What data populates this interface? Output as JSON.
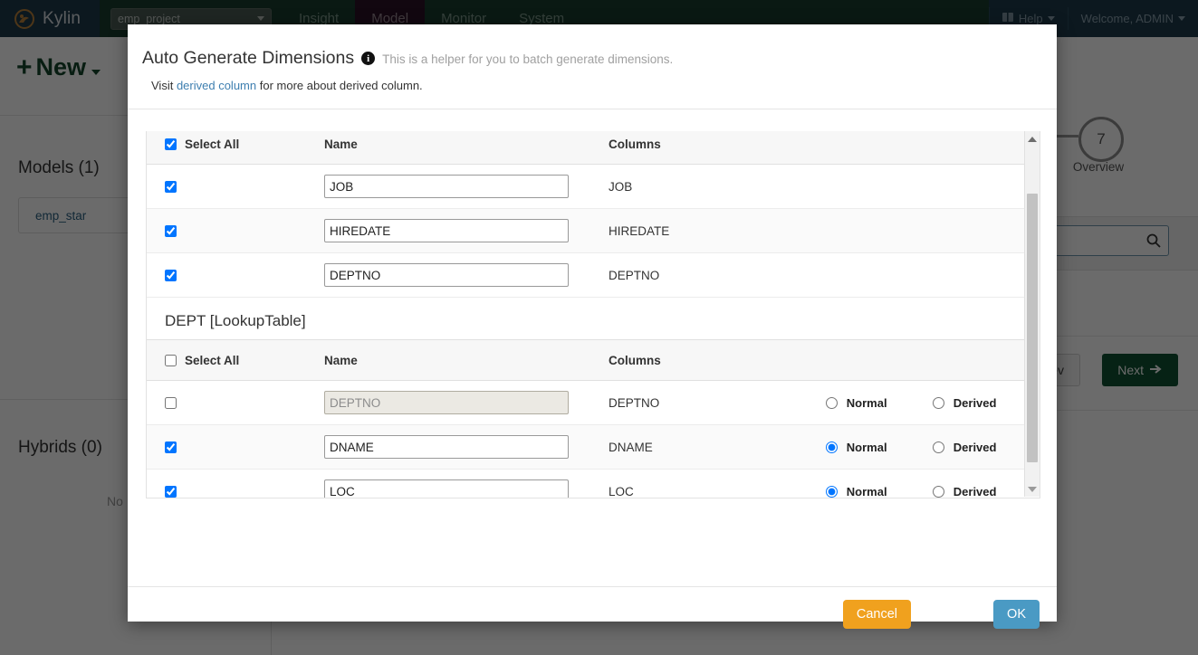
{
  "navbar": {
    "brand": "Kylin",
    "brand_logo_icon": "kylin-logo-icon",
    "project_selected": "emp_project",
    "project_caret_icon": "chevron-down-icon",
    "tabs": [
      {
        "label": "Insight",
        "active": false
      },
      {
        "label": "Model",
        "active": true
      },
      {
        "label": "Monitor",
        "active": false
      },
      {
        "label": "System",
        "active": false
      }
    ],
    "help": {
      "label": "Help",
      "icon": "book-icon",
      "caret_icon": "chevron-down-icon"
    },
    "user": {
      "label": "Welcome, ADMIN",
      "caret_icon": "chevron-down-icon"
    }
  },
  "left_panel": {
    "new_button": {
      "label": "New",
      "plus_icon": "plus-icon",
      "caret_icon": "caret-down-icon"
    },
    "models_title": "Models (1)",
    "model_items": [
      "emp_star"
    ],
    "hybrids_title": "Hybrids (0)",
    "hybrids_empty": "No"
  },
  "wizard": {
    "step_number": "7",
    "step_label": "Overview",
    "search_placeholder": "",
    "search_icon": "search-icon",
    "prev_label": "Prev",
    "next_label": "Next",
    "next_icon": "arrow-right-icon"
  },
  "modal": {
    "title": "Auto Generate Dimensions",
    "info_icon": "info-icon",
    "subtitle": "This is a helper for you to batch generate dimensions.",
    "visit_prefix": "Visit",
    "visit_link": "derived column",
    "visit_suffix": "for more about derived column.",
    "headers": {
      "select_all": "Select All",
      "name": "Name",
      "columns": "Columns"
    },
    "radio_options": {
      "normal": "Normal",
      "derived": "Derived"
    },
    "groups": [
      {
        "title": "",
        "select_all_checked": true,
        "show_header": true,
        "header_clipped": true,
        "has_radios": false,
        "rows": [
          {
            "checked": true,
            "name": "JOB",
            "column": "JOB",
            "disabled": false
          },
          {
            "checked": true,
            "name": "HIREDATE",
            "column": "HIREDATE",
            "disabled": false
          },
          {
            "checked": true,
            "name": "DEPTNO",
            "column": "DEPTNO",
            "disabled": false
          }
        ]
      },
      {
        "title": "DEPT [LookupTable]",
        "select_all_checked": false,
        "show_header": true,
        "header_clipped": false,
        "has_radios": true,
        "rows": [
          {
            "checked": false,
            "name": "DEPTNO",
            "column": "DEPTNO",
            "disabled": true,
            "mode": ""
          },
          {
            "checked": true,
            "name": "DNAME",
            "column": "DNAME",
            "disabled": false,
            "mode": "normal"
          },
          {
            "checked": true,
            "name": "LOC",
            "column": "LOC",
            "disabled": false,
            "mode": "normal"
          }
        ]
      }
    ],
    "footer": {
      "cancel_label": "Cancel",
      "ok_label": "OK"
    },
    "scrollbar": {
      "up_icon": "scroll-up-arrow-icon",
      "down_icon": "scroll-down-arrow-icon"
    }
  },
  "colors": {
    "navbar_bg": "#1d3b4b",
    "nav_green": "#183c2e",
    "nav_active": "#2b1226",
    "cancel_btn": "#f0a11e",
    "ok_btn": "#4a9ac4",
    "next_btn": "#0f5132",
    "link": "#3e7fb0"
  }
}
